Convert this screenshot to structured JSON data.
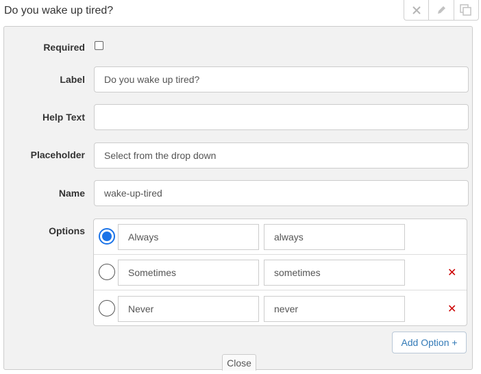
{
  "field": {
    "title": "Do you wake up tired?"
  },
  "actions": [
    {
      "name": "remove",
      "icon": "close-icon"
    },
    {
      "name": "edit",
      "icon": "pencil-icon"
    },
    {
      "name": "copy",
      "icon": "copy-icon"
    }
  ],
  "form": {
    "required": {
      "label": "Required",
      "checked": false
    },
    "label": {
      "label": "Label",
      "value": "Do you wake up tired?"
    },
    "help_text": {
      "label": "Help Text",
      "value": ""
    },
    "placeholder": {
      "label": "Placeholder",
      "value": "Select from the drop down"
    },
    "name": {
      "label": "Name",
      "value": "wake-up-tired"
    },
    "options": {
      "label": "Options",
      "items": [
        {
          "label": "Always",
          "value": "always",
          "selected": true,
          "removable": false
        },
        {
          "label": "Sometimes",
          "value": "sometimes",
          "selected": false,
          "removable": true
        },
        {
          "label": "Never",
          "value": "never",
          "selected": false,
          "removable": true
        }
      ]
    },
    "add_option_label": "Add Option +",
    "close_label": "Close"
  },
  "colors": {
    "accent": "#1a73e8",
    "remove": "#cc0000",
    "link": "#337ab7"
  }
}
